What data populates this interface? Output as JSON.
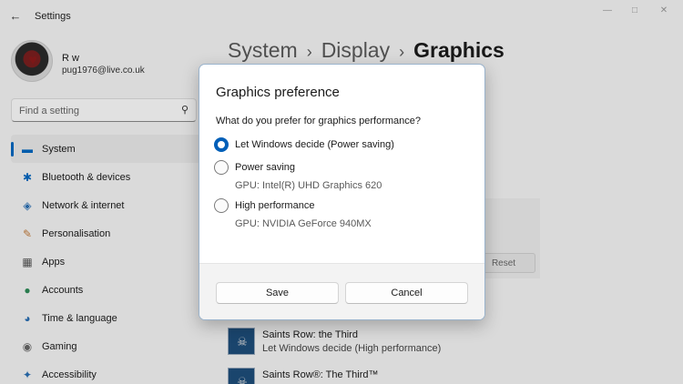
{
  "window": {
    "title": "Settings",
    "back_icon": "arrow-left-icon",
    "controls": [
      "minimize-icon",
      "maximize-icon",
      "close-icon"
    ]
  },
  "profile": {
    "name": "R w",
    "email": "pug1976@live.co.uk"
  },
  "search": {
    "placeholder": "Find a setting",
    "icon": "search-icon"
  },
  "sidebar": {
    "items": [
      {
        "label": "System",
        "icon": "monitor-icon",
        "selected": true
      },
      {
        "label": "Bluetooth & devices",
        "icon": "bluetooth-icon"
      },
      {
        "label": "Network & internet",
        "icon": "wifi-icon"
      },
      {
        "label": "Personalisation",
        "icon": "brush-icon"
      },
      {
        "label": "Apps",
        "icon": "apps-icon"
      },
      {
        "label": "Accounts",
        "icon": "person-icon"
      },
      {
        "label": "Time & language",
        "icon": "globe-clock-icon"
      },
      {
        "label": "Gaming",
        "icon": "gamepad-icon"
      },
      {
        "label": "Accessibility",
        "icon": "accessibility-icon"
      }
    ]
  },
  "breadcrumb": {
    "parts": [
      "System",
      "Display",
      "Graphics"
    ]
  },
  "background": {
    "reset_label": "Reset",
    "apps": [
      {
        "name": "Saints Row: the Third",
        "preference": "Let Windows decide (High performance)"
      },
      {
        "name": "Saints Row®: The Third™",
        "preference": ""
      }
    ]
  },
  "dialog": {
    "title": "Graphics preference",
    "question": "What do you prefer for graphics performance?",
    "options": [
      {
        "label": "Let Windows decide (Power saving)",
        "gpu": "",
        "checked": true
      },
      {
        "label": "Power saving",
        "gpu": "GPU: Intel(R) UHD Graphics 620",
        "checked": false
      },
      {
        "label": "High performance",
        "gpu": "GPU: NVIDIA GeForce 940MX",
        "checked": false
      }
    ],
    "save_label": "Save",
    "cancel_label": "Cancel"
  },
  "colors": {
    "accent": "#005fb8",
    "window_bg": "#f3f3f3",
    "dialog_bg": "#ffffff"
  }
}
